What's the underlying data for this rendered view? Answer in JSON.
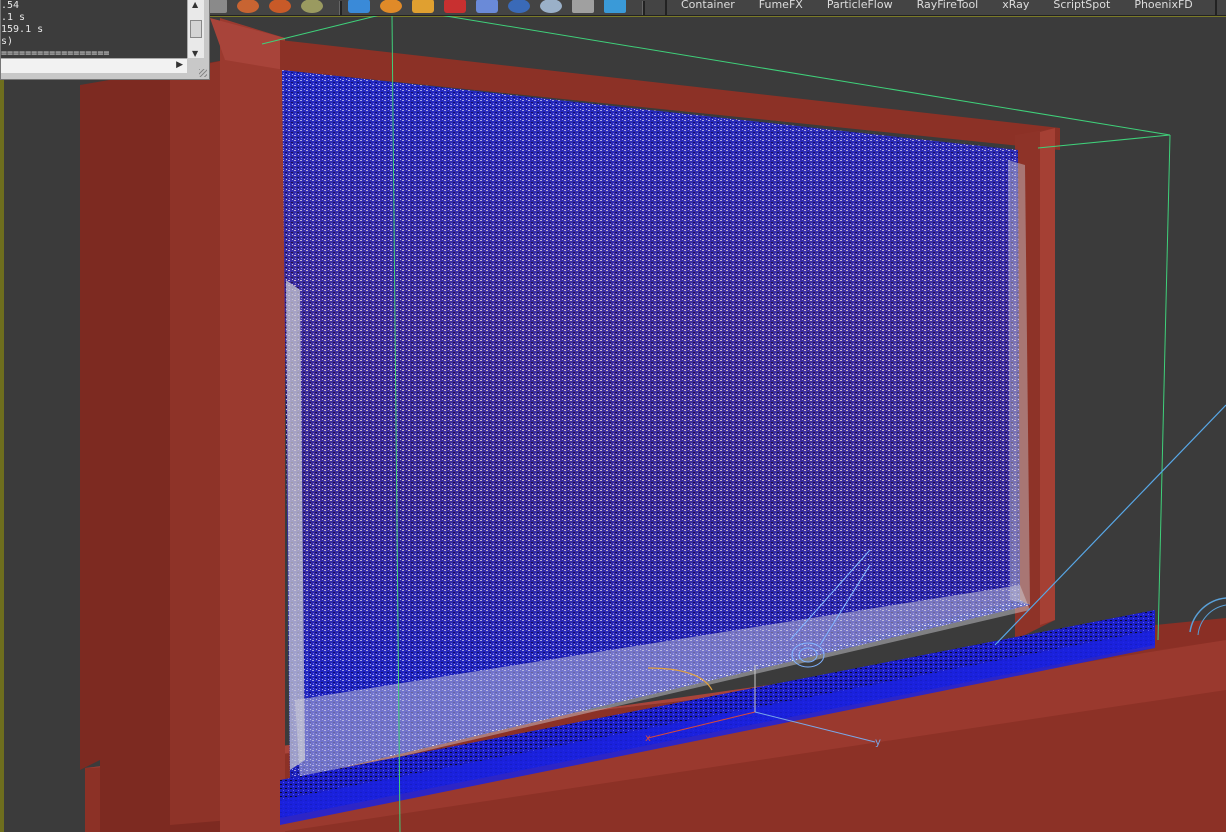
{
  "listener": {
    "lines": [
      ".54",
      ".1 s",
      "  159.1 s",
      "s)",
      "=================="
    ]
  },
  "toolbar": {
    "menu": [
      {
        "label": "Container"
      },
      {
        "label": "FumeFX"
      },
      {
        "label": "ParticleFlow"
      },
      {
        "label": "RayFireTool"
      },
      {
        "label": "xRay"
      },
      {
        "label": "ScriptSpot"
      },
      {
        "label": "PhoenixFD"
      }
    ],
    "icons": [
      "export-icon",
      "teapot-icon",
      "render-icon",
      "cog-icon",
      "material-editor-icon",
      "render-setup-icon",
      "render-frame-icon",
      "lights-icon",
      "rigid-body-icon",
      "shading-icon",
      "globe-icon",
      "landscape-icon",
      "layers-icon"
    ]
  },
  "viewport": {
    "axis_labels": {
      "x": "x",
      "y": "y"
    }
  },
  "colors": {
    "frame": "#8e3328",
    "frame_dark": "#6d251d",
    "particles_blue": "#2d2fd8",
    "particles_white": "#cfcfe6",
    "bbox": "#3fd07a",
    "wire_cyan": "#58a8e8"
  }
}
